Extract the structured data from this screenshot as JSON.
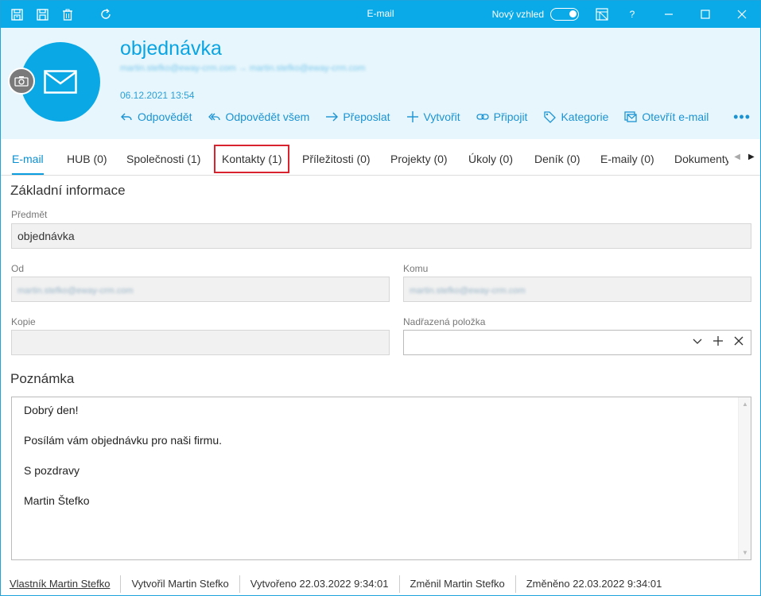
{
  "titlebar": {
    "title": "E-mail",
    "new_look_label": "Nový vzhled",
    "help_label": "?",
    "icons": [
      "save-close-icon",
      "save-icon",
      "delete-icon",
      "refresh-icon",
      "layout-icon",
      "minimize-icon",
      "maximize-icon",
      "close-icon"
    ]
  },
  "header": {
    "subject": "objednávka",
    "addresses": "martin.stefko@eway-crm.com → martin.stefko@eway-crm.com",
    "date": "06.12.2021 13:54",
    "actions": [
      {
        "label": "Odpovědět",
        "icon": "reply-icon"
      },
      {
        "label": "Odpovědět všem",
        "icon": "reply-all-icon"
      },
      {
        "label": "Přeposlat",
        "icon": "forward-icon"
      },
      {
        "label": "Vytvořit",
        "icon": "plus-icon"
      },
      {
        "label": "Připojit",
        "icon": "link-icon"
      },
      {
        "label": "Kategorie",
        "icon": "tag-icon"
      },
      {
        "label": "Otevřít e-mail",
        "icon": "open-mail-icon"
      }
    ],
    "more": "•••"
  },
  "tabs": [
    {
      "label": "E-mail"
    },
    {
      "label": "HUB (0)"
    },
    {
      "label": "Společnosti (1)"
    },
    {
      "label": "Kontakty (1)"
    },
    {
      "label": "Příležitosti (0)"
    },
    {
      "label": "Projekty (0)"
    },
    {
      "label": "Úkoly (0)"
    },
    {
      "label": "Deník (0)"
    },
    {
      "label": "E-maily (0)"
    },
    {
      "label": "Dokumenty"
    }
  ],
  "form": {
    "basic_info_title": "Základní informace",
    "subject_label": "Předmět",
    "subject_value": "objednávka",
    "from_label": "Od",
    "from_value": "martin.stefko@eway-crm.com",
    "to_label": "Komu",
    "to_value": "martin.stefko@eway-crm.com",
    "cc_label": "Kopie",
    "cc_value": "",
    "parent_label": "Nadřazená položka",
    "parent_value": "",
    "note_title": "Poznámka",
    "note_lines": [
      "Dobrý den!",
      "Posílám vám objednávku pro naši firmu.",
      "S pozdravy",
      "Martin Štefko"
    ]
  },
  "footer": {
    "owner": "Vlastník Martin Stefko",
    "created_by": "Vytvořil Martin Stefko",
    "created_at": "Vytvořeno 22.03.2022 9:34:01",
    "changed_by": "Změnil Martin Stefko",
    "changed_at": "Změněno 22.03.2022 9:34:01"
  },
  "colors": {
    "accent": "#0aaae8",
    "header_bg": "#e7f6fc",
    "highlight_border": "#d9232e"
  }
}
